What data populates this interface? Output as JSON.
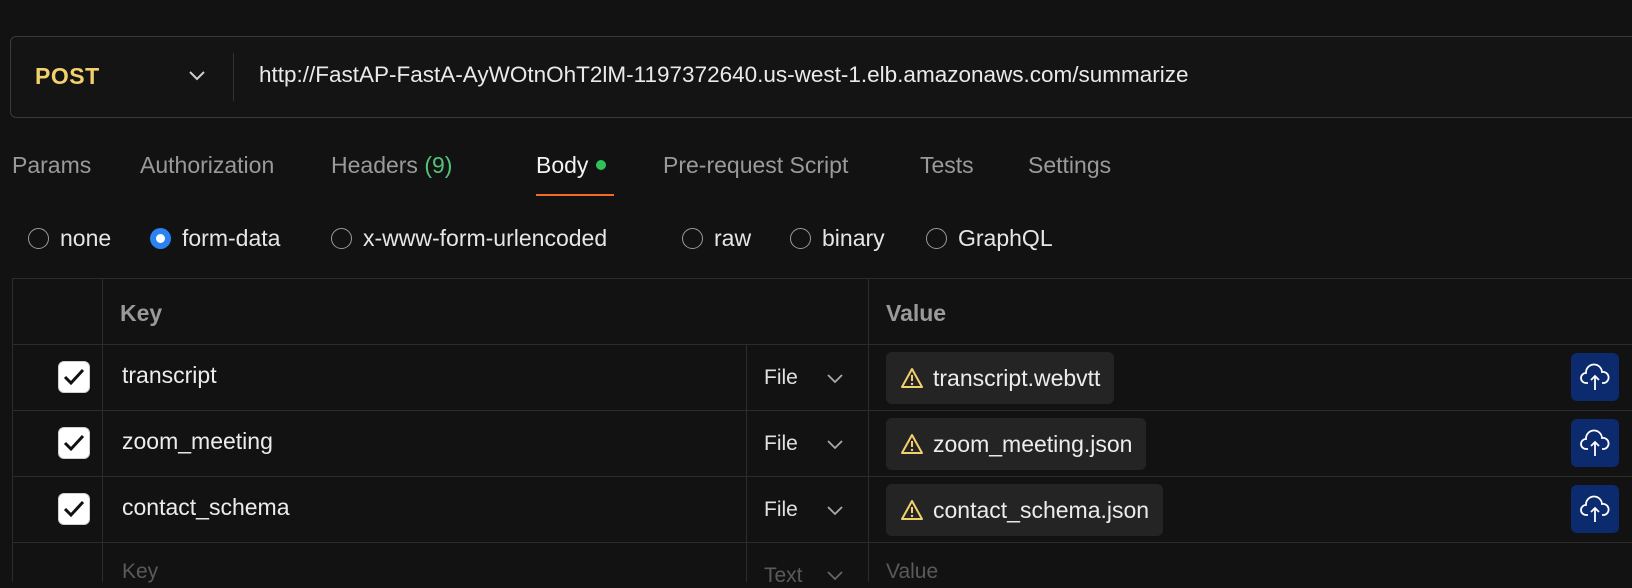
{
  "request": {
    "method": "POST",
    "url": "http://FastAP-FastA-AyWOtnOhT2lM-1197372640.us-west-1.elb.amazonaws.com/summarize"
  },
  "tabs": [
    {
      "label": "Params"
    },
    {
      "label": "Authorization"
    },
    {
      "label": "Headers",
      "count": "(9)"
    },
    {
      "label": "Body",
      "active": true
    },
    {
      "label": "Pre-request Script"
    },
    {
      "label": "Tests"
    },
    {
      "label": "Settings"
    }
  ],
  "body_types": {
    "options": [
      "none",
      "form-data",
      "x-www-form-urlencoded",
      "raw",
      "binary",
      "GraphQL"
    ],
    "selected": "form-data"
  },
  "table": {
    "key_header": "Key",
    "value_header": "Value",
    "rows": [
      {
        "key": "transcript",
        "type": "File",
        "value": "transcript.webvtt",
        "checked": true
      },
      {
        "key": "zoom_meeting",
        "type": "File",
        "value": "zoom_meeting.json",
        "checked": true
      },
      {
        "key": "contact_schema",
        "type": "File",
        "value": "contact_schema.json",
        "checked": true
      }
    ],
    "new_row": {
      "key_placeholder": "Key",
      "type": "Text",
      "value_placeholder": "Value"
    }
  },
  "icons": {
    "method_dropdown": "chevron-down-icon",
    "warning": "warning-icon",
    "upload": "cloud-upload-icon",
    "checkbox": "checkmark-icon"
  },
  "colors": {
    "method": "#f2d06b",
    "active_tab_underline": "#f06a2a",
    "body_dot": "#2fc25a",
    "headers_count": "#54c07a",
    "radio_selected": "#2a83f0",
    "upload_button": "#0c2a6e",
    "warning": "#f2d06b"
  }
}
